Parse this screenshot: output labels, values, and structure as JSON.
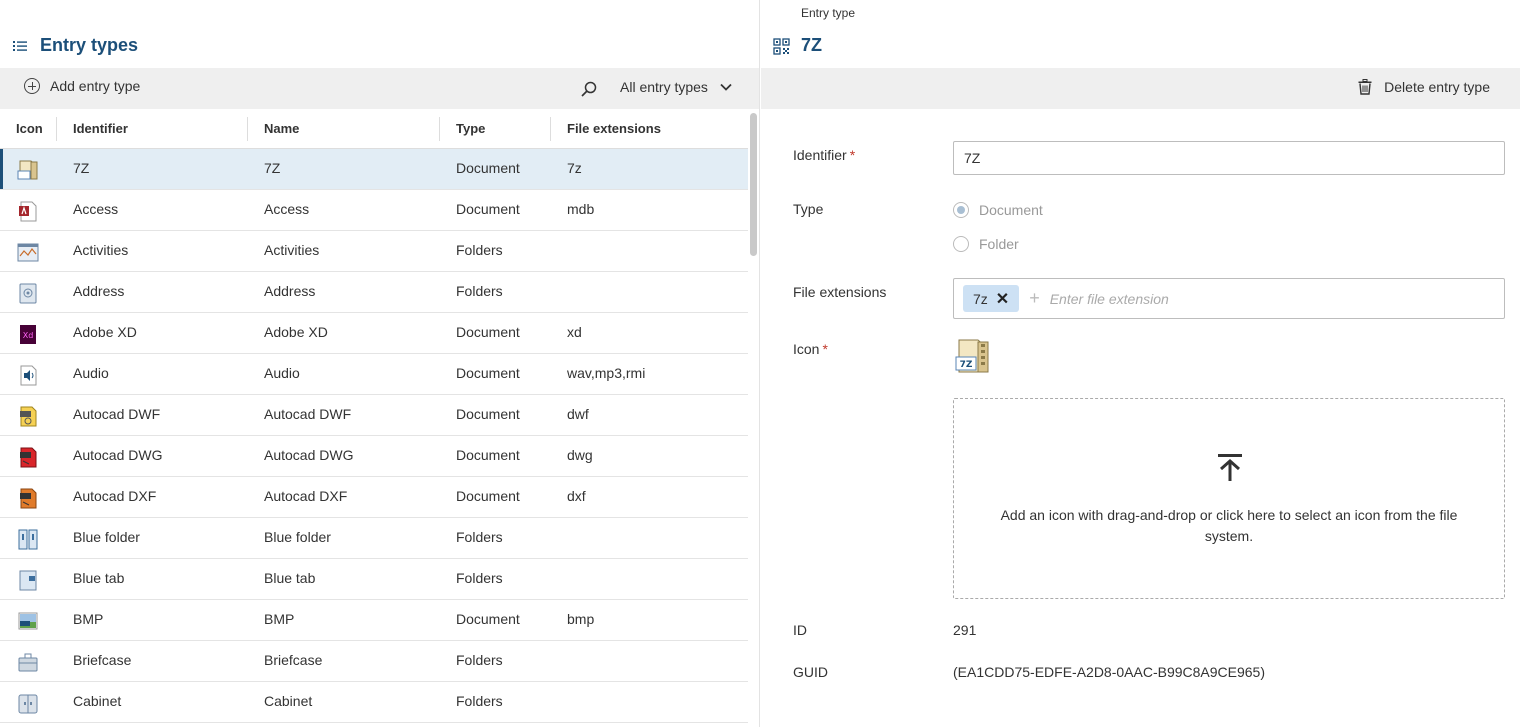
{
  "left": {
    "title": "Entry types",
    "add_label": "Add entry type",
    "filter_label": "All entry types",
    "columns": [
      "Icon",
      "Identifier",
      "Name",
      "Type",
      "File extensions"
    ],
    "rows": [
      {
        "icon": "7z-file-icon",
        "identifier": "7Z",
        "name": "7Z",
        "type": "Document",
        "ext": "7z",
        "selected": true
      },
      {
        "icon": "access-file-icon",
        "identifier": "Access",
        "name": "Access",
        "type": "Document",
        "ext": "mdb"
      },
      {
        "icon": "activities-folder-icon",
        "identifier": "Activities",
        "name": "Activities",
        "type": "Folders",
        "ext": ""
      },
      {
        "icon": "address-folder-icon",
        "identifier": "Address",
        "name": "Address",
        "type": "Folders",
        "ext": ""
      },
      {
        "icon": "adobe-xd-file-icon",
        "identifier": "Adobe XD",
        "name": "Adobe XD",
        "type": "Document",
        "ext": "xd"
      },
      {
        "icon": "audio-file-icon",
        "identifier": "Audio",
        "name": "Audio",
        "type": "Document",
        "ext": "wav,mp3,rmi"
      },
      {
        "icon": "autocad-dwf-file-icon",
        "identifier": "Autocad DWF",
        "name": "Autocad DWF",
        "type": "Document",
        "ext": "dwf"
      },
      {
        "icon": "autocad-dwg-file-icon",
        "identifier": "Autocad DWG",
        "name": "Autocad DWG",
        "type": "Document",
        "ext": "dwg"
      },
      {
        "icon": "autocad-dxf-file-icon",
        "identifier": "Autocad DXF",
        "name": "Autocad DXF",
        "type": "Document",
        "ext": "dxf"
      },
      {
        "icon": "blue-folder-icon",
        "identifier": "Blue folder",
        "name": "Blue folder",
        "type": "Folders",
        "ext": ""
      },
      {
        "icon": "blue-tab-icon",
        "identifier": "Blue tab",
        "name": "Blue tab",
        "type": "Folders",
        "ext": ""
      },
      {
        "icon": "bmp-file-icon",
        "identifier": "BMP",
        "name": "BMP",
        "type": "Document",
        "ext": "bmp"
      },
      {
        "icon": "briefcase-icon",
        "identifier": "Briefcase",
        "name": "Briefcase",
        "type": "Folders",
        "ext": ""
      },
      {
        "icon": "cabinet-icon",
        "identifier": "Cabinet",
        "name": "Cabinet",
        "type": "Folders",
        "ext": ""
      }
    ]
  },
  "right": {
    "eyebrow": "Entry type",
    "title": "7Z",
    "delete_label": "Delete entry type",
    "identifier_label": "Identifier",
    "identifier_value": "7Z",
    "type_label": "Type",
    "type_options": [
      "Document",
      "Folder"
    ],
    "type_selected": "Document",
    "ext_label": "File extensions",
    "ext_chips": [
      "7z"
    ],
    "ext_placeholder": "Enter file extension",
    "icon_label": "Icon",
    "required_mark": "*",
    "dropzone_text": "Add an icon with drag-and-drop or click here to select an icon from the file system.",
    "id_label": "ID",
    "id_value": "291",
    "guid_label": "GUID",
    "guid_value": "(EA1CDD75-EDFE-A2D8-0AAC-B99C8A9CE965)"
  },
  "colors": {
    "accent": "#1c4f79",
    "selected_row": "#e2edf5",
    "toolbar": "#efefef",
    "chip": "#cde1f4",
    "required": "#c0392b"
  }
}
